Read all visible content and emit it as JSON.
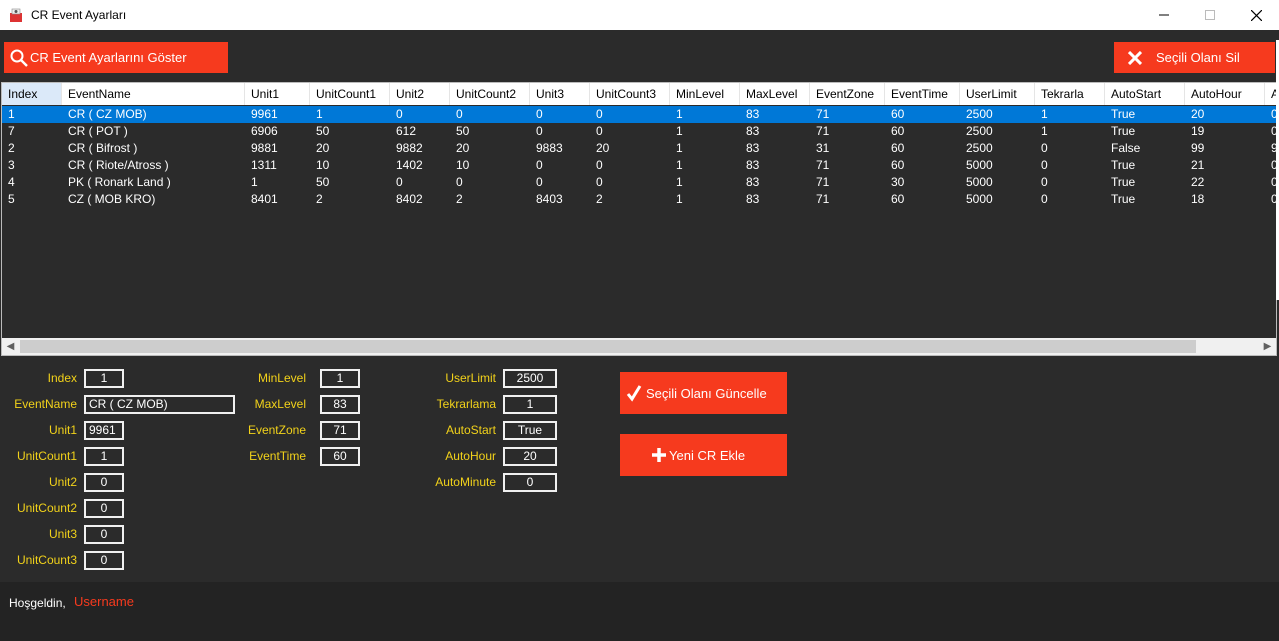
{
  "window": {
    "title": "CR Event Ayarları"
  },
  "toolbar": {
    "show_label": "CR Event Ayarlarını Göster",
    "delete_label": "Seçili Olanı Sil"
  },
  "grid": {
    "columns": [
      "Index",
      "EventName",
      "Unit1",
      "UnitCount1",
      "Unit2",
      "UnitCount2",
      "Unit3",
      "UnitCount3",
      "MinLevel",
      "MaxLevel",
      "EventZone",
      "EventTime",
      "UserLimit",
      "Tekrarla",
      "AutoStart",
      "AutoHour",
      "A"
    ],
    "rows": [
      [
        "1",
        "CR ( CZ MOB)",
        "9961",
        "1",
        "0",
        "0",
        "0",
        "0",
        "1",
        "83",
        "71",
        "60",
        "2500",
        "1",
        "True",
        "20",
        "0"
      ],
      [
        "7",
        "CR ( POT )",
        "6906",
        "50",
        "612",
        "50",
        "0",
        "0",
        "1",
        "83",
        "71",
        "60",
        "2500",
        "1",
        "True",
        "19",
        "0"
      ],
      [
        "2",
        "CR ( Bifrost )",
        "9881",
        "20",
        "9882",
        "20",
        "9883",
        "20",
        "1",
        "83",
        "31",
        "60",
        "2500",
        "0",
        "False",
        "99",
        "9"
      ],
      [
        "3",
        "CR ( Riote/Atross )",
        "1311",
        "10",
        "1402",
        "10",
        "0",
        "0",
        "1",
        "83",
        "71",
        "60",
        "5000",
        "0",
        "True",
        "21",
        "0"
      ],
      [
        "4",
        "PK ( Ronark Land )",
        "1",
        "50",
        "0",
        "0",
        "0",
        "0",
        "1",
        "83",
        "71",
        "30",
        "5000",
        "0",
        "True",
        "22",
        "0"
      ],
      [
        "5",
        "CZ ( MOB KRO)",
        "8401",
        "2",
        "8402",
        "2",
        "8403",
        "2",
        "1",
        "83",
        "71",
        "60",
        "5000",
        "0",
        "True",
        "18",
        "0"
      ]
    ],
    "selected_row": 0
  },
  "form": {
    "col1": [
      {
        "label": "Index",
        "value": "1"
      },
      {
        "label": "EventName",
        "value": "CR ( CZ MOB)"
      },
      {
        "label": "Unit1",
        "value": "9961"
      },
      {
        "label": "UnitCount1",
        "value": "1"
      },
      {
        "label": "Unit2",
        "value": "0"
      },
      {
        "label": "UnitCount2",
        "value": "0"
      },
      {
        "label": "Unit3",
        "value": "0"
      },
      {
        "label": "UnitCount3",
        "value": "0"
      }
    ],
    "col2": [
      {
        "label": "MinLevel",
        "value": "1"
      },
      {
        "label": "MaxLevel",
        "value": "83"
      },
      {
        "label": "EventZone",
        "value": "71"
      },
      {
        "label": "EventTime",
        "value": "60"
      }
    ],
    "col3": [
      {
        "label": "UserLimit",
        "value": "2500"
      },
      {
        "label": "Tekrarlama",
        "value": "1"
      },
      {
        "label": "AutoStart",
        "value": "True"
      },
      {
        "label": "AutoHour",
        "value": "20"
      },
      {
        "label": "AutoMinute",
        "value": "0"
      }
    ]
  },
  "actions": {
    "update_label": "Seçili Olanı Güncelle",
    "add_label": "Yeni CR Ekle"
  },
  "footer": {
    "welcome": "Hoşgeldin,",
    "username": "Username"
  },
  "icons": {
    "app": "event-icon",
    "show": "magnifier-icon",
    "delete": "x-icon",
    "update": "checkmark-icon",
    "add": "plus-icon"
  },
  "colors": {
    "accent": "#f63a1e",
    "label": "#f2d21a",
    "selection": "#0078d7",
    "background": "#2b2b2b"
  }
}
